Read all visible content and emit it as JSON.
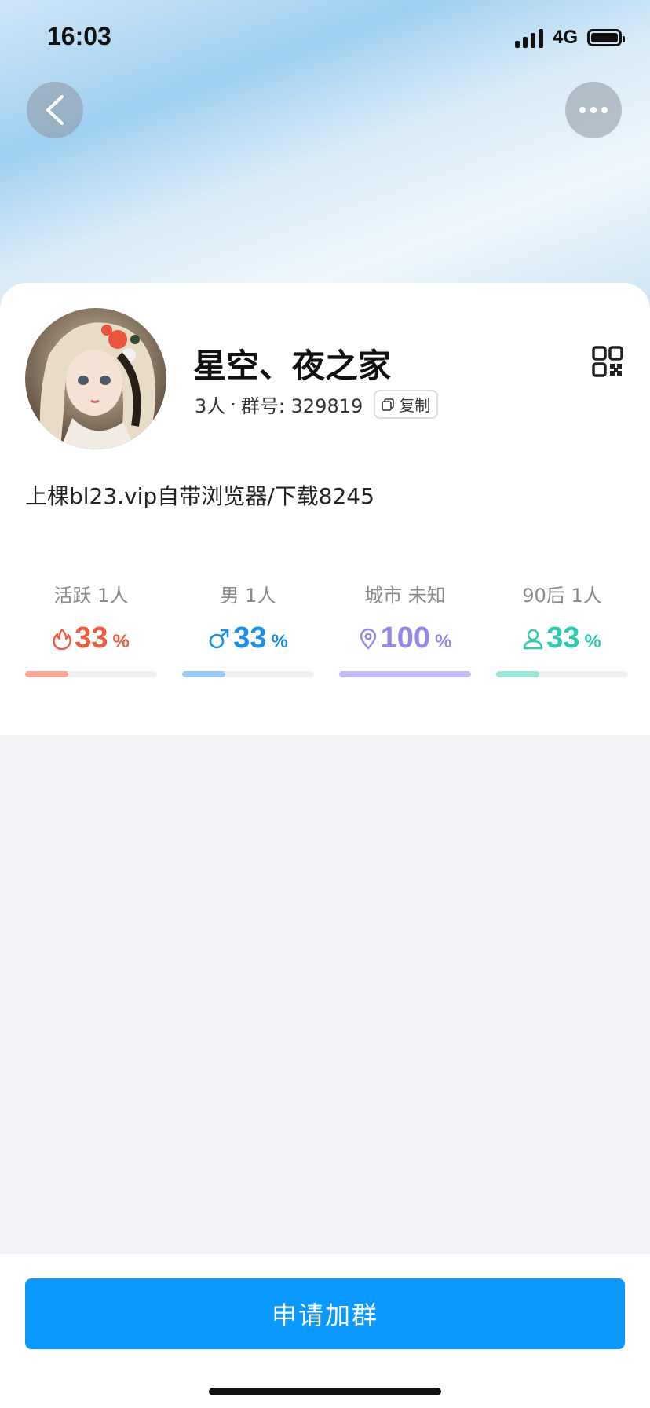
{
  "status_bar": {
    "time": "16:03",
    "network": "4G"
  },
  "group": {
    "name": "星空、夜之家",
    "members": "3人",
    "separator": "·",
    "id_label": "群号: 329819",
    "copy_label": "复制",
    "description": "上棵bl23.vip自带浏览器/下载8245"
  },
  "stats": [
    {
      "label": "活跃 1人",
      "value": "33",
      "unit": "%",
      "percent": 33,
      "color": "#f05a3e",
      "bar_color": "#f7a596",
      "icon": "flame-icon"
    },
    {
      "label": "男 1人",
      "value": "33",
      "unit": "%",
      "percent": 33,
      "color": "#1a8fe6",
      "bar_color": "#9cc9f2",
      "icon": "male-icon"
    },
    {
      "label": "城市 未知",
      "value": "100",
      "unit": "%",
      "percent": 100,
      "color": "#9a86e8",
      "bar_color": "#c7bbf2",
      "icon": "location-pin-icon"
    },
    {
      "label": "90后 1人",
      "value": "33",
      "unit": "%",
      "percent": 33,
      "color": "#2ecbb0",
      "bar_color": "#9fe5d8",
      "icon": "person-icon"
    }
  ],
  "actions": {
    "join_label": "申请加群"
  },
  "colors": {
    "primary": "#0a98ff",
    "background": "#f2f2f7"
  }
}
